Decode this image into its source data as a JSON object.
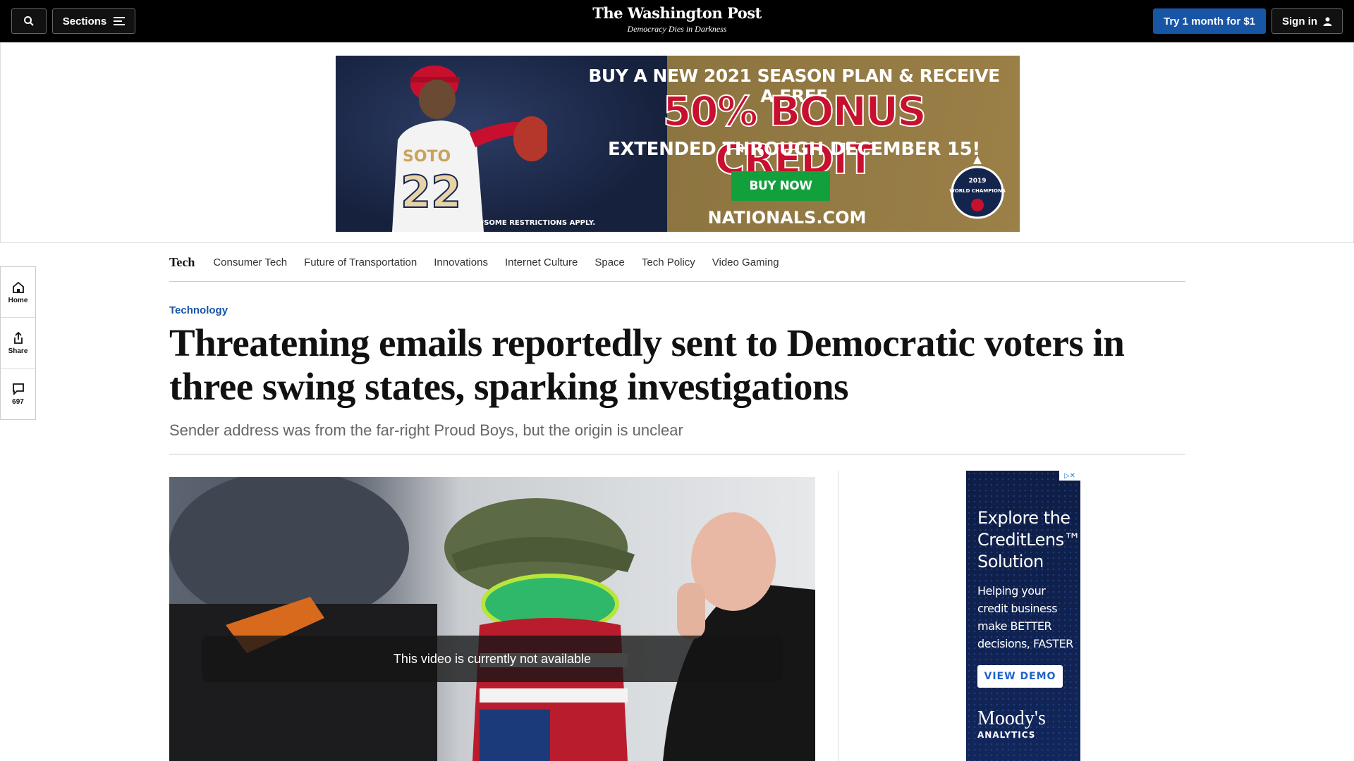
{
  "header": {
    "sections_label": "Sections",
    "logo_name": "The Washington Post",
    "logo_tagline": "Democracy Dies in Darkness",
    "subscribe_label": "Try 1 month for $1",
    "signin_label": "Sign in"
  },
  "top_ad": {
    "line1": "BUY A NEW 2021 SEASON PLAN & RECEIVE A FREE",
    "line2": "50% BONUS CREDIT",
    "line3": "EXTENDED THROUGH DECEMBER 15!",
    "button": "BUY NOW",
    "restriction": "*SOME RESTRICTIONS APPLY.",
    "site": "NATIONALS.COM",
    "badge_year": "2019",
    "badge_text": "WORLD CHAMPIONS",
    "jersey_name": "SOTO",
    "jersey_number": "22"
  },
  "rail": {
    "home_label": "Home",
    "share_label": "Share",
    "comments_count": "697"
  },
  "subnav": {
    "title": "Tech",
    "items": [
      "Consumer Tech",
      "Future of Transportation",
      "Innovations",
      "Internet Culture",
      "Space",
      "Tech Policy",
      "Video Gaming"
    ]
  },
  "article": {
    "kicker": "Technology",
    "headline": "Threatening emails reportedly sent to Democratic voters in three swing states, sparking investigations",
    "dek": "Sender address was from the far-right Proud Boys, but the origin is unclear",
    "video_message": "This video is currently not available"
  },
  "side_ad": {
    "title": "Explore the CreditLens™ Solution",
    "body": "Helping your credit business make BETTER decisions, FASTER",
    "button": "VIEW DEMO",
    "brand": "Moody's",
    "brand_sub": "ANALYTICS"
  },
  "colors": {
    "topbar": "#000000",
    "accent_blue": "#1955a5",
    "kicker_blue": "#1955a5"
  }
}
